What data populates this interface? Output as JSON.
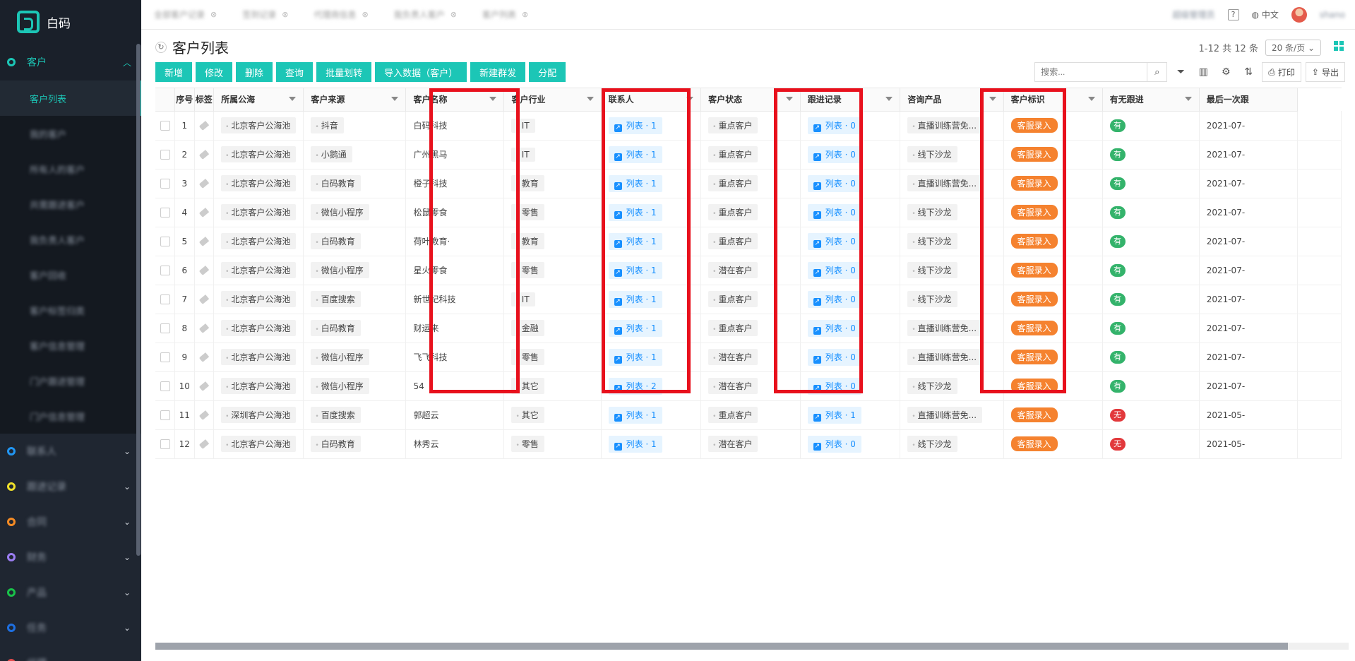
{
  "app": {
    "name": "白码"
  },
  "sidebar": {
    "active_menu": {
      "label": "客户"
    },
    "sub_items": [
      "客户列表",
      "我的客户",
      "所有人的客户",
      "共需跟进客户",
      "我负责人客户",
      "客户回收",
      "客户标签归类",
      "客户信息管理",
      "门户跟进管理",
      "门户信息管理"
    ],
    "groups": [
      {
        "label": "联系人",
        "color": "#2196f3"
      },
      {
        "label": "跟进记录",
        "color": "#f0e12a"
      },
      {
        "label": "合同",
        "color": "#f58b24"
      },
      {
        "label": "财务",
        "color": "#9b7df2"
      },
      {
        "label": "产品",
        "color": "#19c24a"
      },
      {
        "label": "任务",
        "color": "#1e6fe0"
      },
      {
        "label": "代理",
        "color": "#e24b4b"
      }
    ]
  },
  "topbar": {
    "tabs": [
      "全部客户记录",
      "签到记录",
      "代理商信息",
      "我负责人客户",
      "客户列表"
    ],
    "user_info": "超级管理员",
    "language": "中文",
    "username": "shano"
  },
  "page": {
    "title": "客户列表",
    "pager_text": "1-12 共 12 条",
    "page_size": "20 条/页",
    "search_placeholder": "搜索...",
    "print_label": "打印",
    "export_label": "导出"
  },
  "toolbar": [
    "新增",
    "修改",
    "删除",
    "查询",
    "批量划转",
    "导入数据（客户）",
    "新建群发",
    "分配"
  ],
  "table": {
    "columns": [
      "序号",
      "标签",
      "所属公海",
      "客户来源",
      "客户名称",
      "客户行业",
      "联系人",
      "客户状态",
      "跟进记录",
      "咨询产品",
      "客户标识",
      "有无跟进",
      "最后一次跟"
    ],
    "rows": [
      {
        "no": "1",
        "pool": "北京客户公海池",
        "source": "抖音",
        "name": "白码科技",
        "industry": "IT",
        "contacts": "列表 · 1",
        "status": "重点客户",
        "follow": "列表 · 0",
        "product": "直播训练营免...",
        "tag": "客服录入",
        "has_follow": "有",
        "last": "2021-07-"
      },
      {
        "no": "2",
        "pool": "北京客户公海池",
        "source": "小鹅通",
        "name": "广州黑马",
        "industry": "IT",
        "contacts": "列表 · 1",
        "status": "重点客户",
        "follow": "列表 · 0",
        "product": "线下沙龙",
        "tag": "客服录入",
        "has_follow": "有",
        "last": "2021-07-"
      },
      {
        "no": "3",
        "pool": "北京客户公海池",
        "source": "白码教育",
        "name": "橙子科技",
        "industry": "教育",
        "contacts": "列表 · 1",
        "status": "重点客户",
        "follow": "列表 · 0",
        "product": "直播训练营免...",
        "tag": "客服录入",
        "has_follow": "有",
        "last": "2021-07-"
      },
      {
        "no": "4",
        "pool": "北京客户公海池",
        "source": "微信小程序",
        "name": "松鼠零食",
        "industry": "零售",
        "contacts": "列表 · 1",
        "status": "重点客户",
        "follow": "列表 · 0",
        "product": "线下沙龙",
        "tag": "客服录入",
        "has_follow": "有",
        "last": "2021-07-"
      },
      {
        "no": "5",
        "pool": "北京客户公海池",
        "source": "白码教育",
        "name": "荷叶教育·",
        "industry": "教育",
        "contacts": "列表 · 1",
        "status": "重点客户",
        "follow": "列表 · 0",
        "product": "线下沙龙",
        "tag": "客服录入",
        "has_follow": "有",
        "last": "2021-07-"
      },
      {
        "no": "6",
        "pool": "北京客户公海池",
        "source": "微信小程序",
        "name": "星火零食",
        "industry": "零售",
        "contacts": "列表 · 1",
        "status": "潜在客户",
        "follow": "列表 · 0",
        "product": "线下沙龙",
        "tag": "客服录入",
        "has_follow": "有",
        "last": "2021-07-"
      },
      {
        "no": "7",
        "pool": "北京客户公海池",
        "source": "百度搜索",
        "name": "新世纪科技",
        "industry": "IT",
        "contacts": "列表 · 1",
        "status": "重点客户",
        "follow": "列表 · 0",
        "product": "线下沙龙",
        "tag": "客服录入",
        "has_follow": "有",
        "last": "2021-07-"
      },
      {
        "no": "8",
        "pool": "北京客户公海池",
        "source": "白码教育",
        "name": "财运来",
        "industry": "金融",
        "contacts": "列表 · 1",
        "status": "重点客户",
        "follow": "列表 · 0",
        "product": "直播训练营免...",
        "tag": "客服录入",
        "has_follow": "有",
        "last": "2021-07-"
      },
      {
        "no": "9",
        "pool": "北京客户公海池",
        "source": "微信小程序",
        "name": "飞飞科技",
        "industry": "零售",
        "contacts": "列表 · 1",
        "status": "潜在客户",
        "follow": "列表 · 0",
        "product": "直播训练营免...",
        "tag": "客服录入",
        "has_follow": "有",
        "last": "2021-07-"
      },
      {
        "no": "10",
        "pool": "北京客户公海池",
        "source": "微信小程序",
        "name": "54",
        "industry": "其它",
        "contacts": "列表 · 2",
        "status": "潜在客户",
        "follow": "列表 · 0",
        "product": "线下沙龙",
        "tag": "客服录入",
        "has_follow": "有",
        "last": "2021-07-"
      },
      {
        "no": "11",
        "pool": "深圳客户公海池",
        "source": "百度搜索",
        "name": "郭超云",
        "industry": "其它",
        "contacts": "列表 · 1",
        "status": "重点客户",
        "follow": "列表 · 1",
        "product": "直播训练营免...",
        "tag": "客服录入",
        "has_follow": "无",
        "last": "2021-05-"
      },
      {
        "no": "12",
        "pool": "北京客户公海池",
        "source": "白码教育",
        "name": "林秀云",
        "industry": "零售",
        "contacts": "列表 · 1",
        "status": "潜在客户",
        "follow": "列表 · 0",
        "product": "线下沙龙",
        "tag": "客服录入",
        "has_follow": "无",
        "last": "2021-05-"
      }
    ]
  },
  "colors": {
    "accent": "#1cc6b6",
    "highlight": "#e8101c",
    "tag_orange": "#f5822f",
    "yes_green": "#34b36b",
    "no_red": "#e2393c"
  }
}
